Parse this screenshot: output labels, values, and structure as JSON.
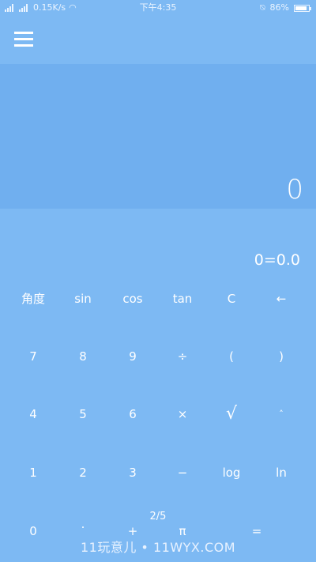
{
  "status_bar": {
    "network_speed": "0.15K/s",
    "time": "下午4:35",
    "battery_percent": "86%",
    "battery_level": 0.86,
    "icons": [
      "signal-icon",
      "signal-icon",
      "wifi-icon",
      "alarm-icon",
      "battery-icon"
    ]
  },
  "display": {
    "current_value": "0",
    "result_line": "0=0.0"
  },
  "keypad": {
    "row1": [
      "角度",
      "sin",
      "cos",
      "tan",
      "C",
      "←"
    ],
    "row2": [
      "7",
      "8",
      "9",
      "÷",
      "(",
      ")"
    ],
    "row3": [
      "4",
      "5",
      "6",
      "×",
      "√",
      "˄"
    ],
    "row4": [
      "1",
      "2",
      "3",
      "−",
      "log",
      "ln"
    ],
    "row5": [
      "0",
      ".",
      "+",
      "π",
      "",
      "="
    ]
  },
  "page_indicator": "2/5",
  "watermark": "11玩意儿 • 11WYX.COM"
}
